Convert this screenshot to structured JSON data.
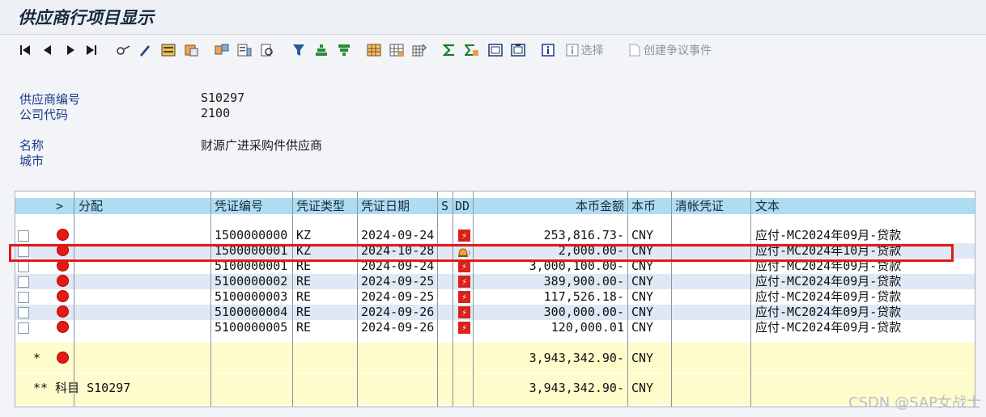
{
  "window": {
    "title": "供应商行项目显示"
  },
  "toolbar": {
    "icons": [
      "first-page-icon",
      "prev-page-icon",
      "next-page-icon",
      "last-page-icon",
      "details-icon",
      "edit-icon",
      "select-layout-icon",
      "transfer-icon",
      "sort-icon",
      "find-icon",
      "print-preview-icon",
      "filter-icon",
      "sort-asc-icon",
      "sort-desc-icon",
      "grid-icon",
      "grid-sub-icon",
      "export-icon",
      "sum-icon",
      "subtotal-icon",
      "layout-save-icon",
      "layout-change-icon",
      "info-icon"
    ],
    "select_label": "选择",
    "dispute_label": "创建争议事件"
  },
  "header": {
    "vendor_label": "供应商编号",
    "vendor_value": "S10297",
    "company_label": "公司代码",
    "company_value": "2100",
    "name_label": "名称",
    "name_value": "财源广进采购件供应商",
    "city_label": "城市",
    "city_value": ""
  },
  "table": {
    "columns": {
      "expand": ">",
      "assign": "分配",
      "doc_no": "凭证编号",
      "doc_type": "凭证类型",
      "doc_date": "凭证日期",
      "s": "S",
      "dd": "DD",
      "amount": "本币金额",
      "currency": "本币",
      "clearing_doc": "清帐凭证",
      "text": "文本"
    },
    "rows": [
      {
        "doc_no": "1500000000",
        "doc_type": "KZ",
        "doc_date": "2024-09-24",
        "dd": "ddue-icon",
        "amount": "253,816.73-",
        "currency": "CNY",
        "text": "应付-MC2024年09月-贷款"
      },
      {
        "doc_no": "1500000001",
        "doc_type": "KZ",
        "doc_date": "2024-10-28",
        "dd": "bell-icon",
        "amount": "2,000.00-",
        "currency": "CNY",
        "text": "应付-MC2024年10月-贷款"
      },
      {
        "doc_no": "5100000001",
        "doc_type": "RE",
        "doc_date": "2024-09-24",
        "dd": "ddue-icon",
        "amount": "3,000,100.00-",
        "currency": "CNY",
        "text": "应付-MC2024年09月-贷款"
      },
      {
        "doc_no": "5100000002",
        "doc_type": "RE",
        "doc_date": "2024-09-25",
        "dd": "ddue-icon",
        "amount": "389,900.00-",
        "currency": "CNY",
        "text": "应付-MC2024年09月-贷款"
      },
      {
        "doc_no": "5100000003",
        "doc_type": "RE",
        "doc_date": "2024-09-25",
        "dd": "ddue-icon",
        "amount": "117,526.18-",
        "currency": "CNY",
        "text": "应付-MC2024年09月-贷款"
      },
      {
        "doc_no": "5100000004",
        "doc_type": "RE",
        "doc_date": "2024-09-26",
        "dd": "ddue-icon",
        "amount": "300,000.00-",
        "currency": "CNY",
        "text": "应付-MC2024年09月-贷款"
      },
      {
        "doc_no": "5100000005",
        "doc_type": "RE",
        "doc_date": "2024-09-26",
        "dd": "ddue-icon",
        "amount": "120,000.01",
        "currency": "CNY",
        "text": "应付-MC2024年09月-贷款"
      }
    ],
    "subtotal": {
      "marker": "*",
      "amount": "3,943,342.90-",
      "currency": "CNY"
    },
    "total": {
      "label": "** 科目 S10297",
      "amount": "3,943,342.90-",
      "currency": "CNY"
    }
  },
  "watermark": "CSDN @SAP女战士",
  "colors": {
    "header_bg": "#aedcf0",
    "sum_bg": "#fffccc",
    "status_red": "#e31b12",
    "highlight": "#e01818",
    "row_alt": "#dfe8f5"
  }
}
